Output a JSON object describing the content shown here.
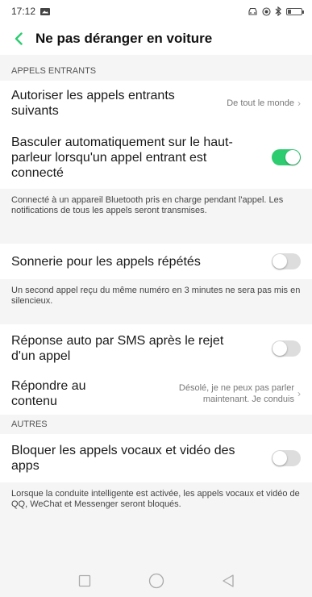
{
  "status": {
    "time": "17:12"
  },
  "header": {
    "title": "Ne pas déranger en voiture"
  },
  "sections": {
    "incoming": {
      "header": "APPELS ENTRANTS",
      "allow_calls": {
        "label": "Autoriser les appels entrants suivants",
        "value": "De tout le monde"
      },
      "speaker": {
        "label": "Basculer automatiquement sur le haut-parleur lorsqu'un appel entrant est connecté",
        "enabled": true
      },
      "speaker_desc": "Connecté à un appareil Bluetooth pris en charge pendant l'appel. Les notifications de tous les appels seront transmises.",
      "repeat": {
        "label": "Sonnerie pour les appels répétés",
        "enabled": false
      },
      "repeat_desc": "Un second appel reçu du même numéro en 3 minutes ne sera pas mis en silencieux.",
      "auto_sms": {
        "label": "Réponse auto par SMS après le rejet d'un appel",
        "enabled": false
      },
      "reply_content": {
        "label": "Répondre au contenu",
        "value": "Désolé, je ne peux pas parler maintenant. Je conduis"
      }
    },
    "others": {
      "header": "AUTRES",
      "block_apps": {
        "label": "Bloquer les appels vocaux et vidéo des apps",
        "enabled": false
      },
      "block_desc": "Lorsque la conduite intelligente est activée, les appels vocaux et vidéo de QQ, WeChat et Messenger seront bloqués."
    }
  },
  "colors": {
    "accent": "#2ecc71"
  },
  "icons": {
    "back": "chevron-left-icon",
    "nav": [
      "square-icon",
      "circle-icon",
      "triangle-back-icon"
    ]
  }
}
